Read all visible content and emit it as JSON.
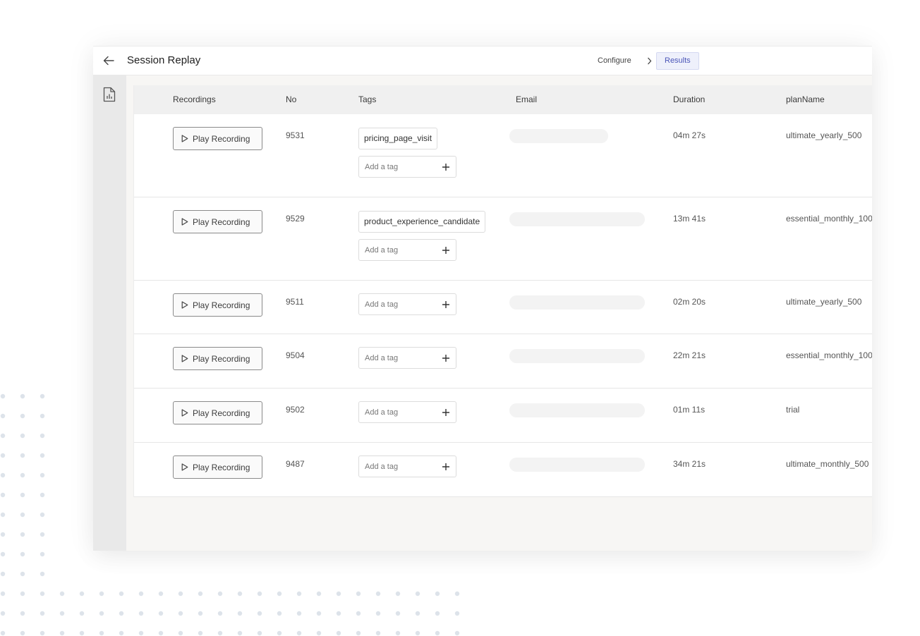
{
  "header": {
    "title": "Session Replay",
    "breadcrumb": {
      "configure": "Configure",
      "results": "Results"
    }
  },
  "icons": {
    "back": "arrow-left-icon",
    "chevron": "chevron-right-icon",
    "report": "report-file-icon",
    "play": "play-icon",
    "add": "plus-icon"
  },
  "colors": {
    "accent": "#4a55b8",
    "accent_bg": "#eef0fb",
    "sidebar_bg": "#e9e9e9",
    "table_header_bg": "#f0f0f0"
  },
  "table": {
    "columns": [
      "Recordings",
      "No",
      "Tags",
      "Email",
      "Duration",
      "planName"
    ],
    "play_label": "Play Recording",
    "add_tag_placeholder": "Add a tag",
    "rows": [
      {
        "no": "9531",
        "tags": [
          "pricing_page_visit"
        ],
        "duration": "04m 27s",
        "plan": "ultimate_yearly_500"
      },
      {
        "no": "9529",
        "tags": [
          "product_experience_candidate"
        ],
        "duration": "13m 41s",
        "plan": "essential_monthly_100"
      },
      {
        "no": "9511",
        "tags": [],
        "duration": "02m 20s",
        "plan": "ultimate_yearly_500"
      },
      {
        "no": "9504",
        "tags": [],
        "duration": "22m 21s",
        "plan": "essential_monthly_100"
      },
      {
        "no": "9502",
        "tags": [],
        "duration": "01m 11s",
        "plan": "trial"
      },
      {
        "no": "9487",
        "tags": [],
        "duration": "34m 21s",
        "plan": "ultimate_monthly_500"
      }
    ]
  }
}
